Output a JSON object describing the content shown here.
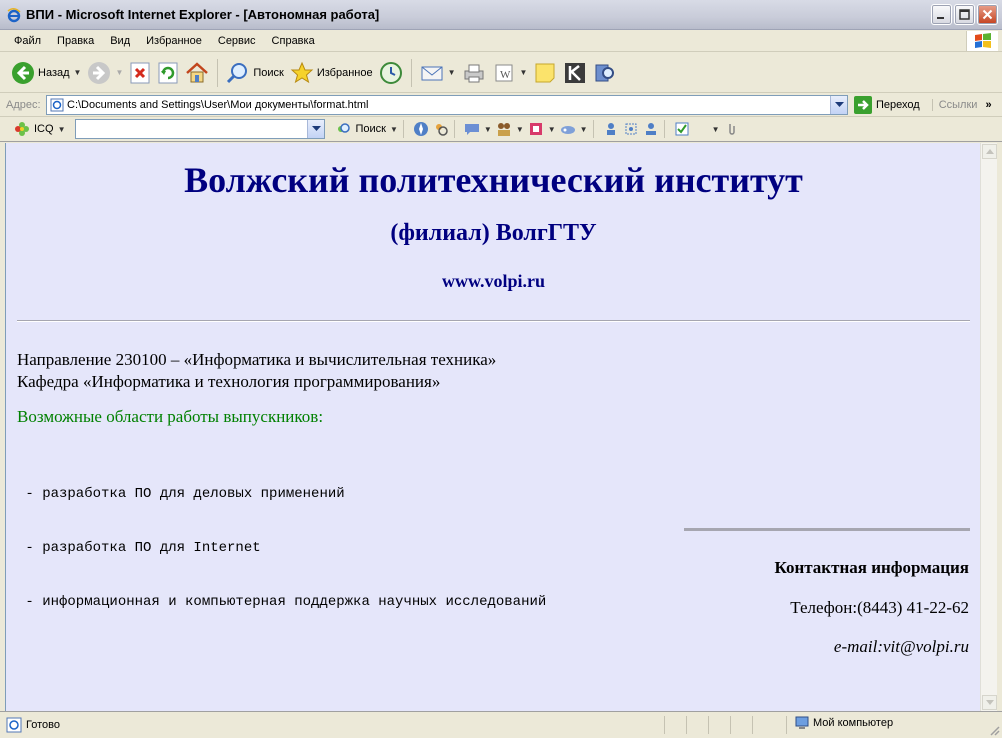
{
  "window": {
    "title": "ВПИ - Microsoft Internet Explorer - [Автономная работа]"
  },
  "menu": [
    "Файл",
    "Правка",
    "Вид",
    "Избранное",
    "Сервис",
    "Справка"
  ],
  "toolbar": {
    "back_label": "Назад",
    "search_label": "Поиск",
    "favorites_label": "Избранное"
  },
  "address": {
    "label": "Адрес:",
    "value": "C:\\Documents and Settings\\User\\Мои документы\\format.html",
    "go_label": "Переход",
    "links_label": "Ссылки"
  },
  "icq": {
    "label": "ICQ",
    "search_label": "Поиск",
    "search_value": ""
  },
  "page": {
    "heading": "Волжский политехнический институт",
    "subheading": "(филиал) ВолгГТУ",
    "site": "www.volpi.ru",
    "direction": "Направление 230100 – «Информатика и вычислительная техника»",
    "department": "Кафедра «Информатика и технология программирования»",
    "areas_title": "Возможные области работы выпускников:",
    "areas": [
      " - разработка ПО для деловых применений",
      " - разработка ПО для Internet",
      " - информационная и компьютерная поддержка научных исследований"
    ],
    "contact_title": "Контактная информация",
    "phone": "Телефон:(8443) 41-22-62",
    "email": "e-mail:vit@volpi.ru"
  },
  "status": {
    "text": "Готово",
    "zone": "Мой компьютер"
  },
  "colors": {
    "heading": "#000080",
    "areas_title": "#008000",
    "page_bg": "#e5e6fa"
  }
}
